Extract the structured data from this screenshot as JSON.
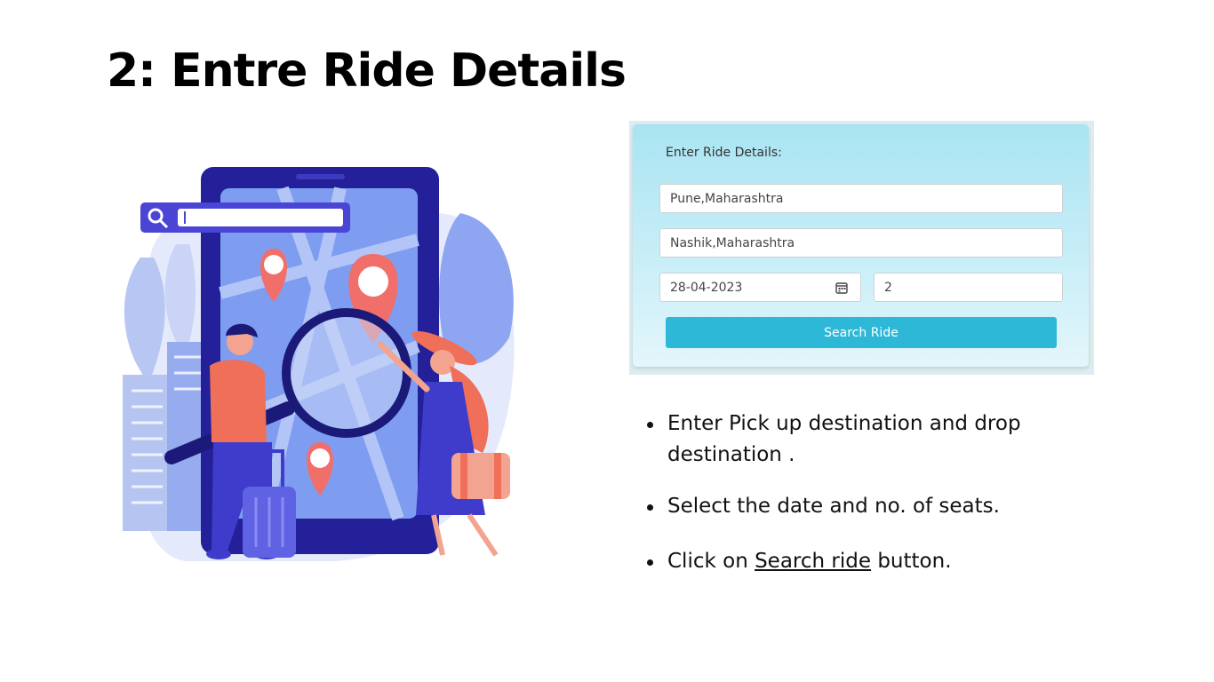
{
  "slide": {
    "title": "2: Entre Ride Details"
  },
  "form": {
    "heading": "Enter Ride Details:",
    "pickup_value": "Pune,Maharashtra",
    "drop_value": "Nashik,Maharashtra",
    "date_value": "28-04-2023",
    "seats_value": "2",
    "search_button_label": "Search Ride",
    "date_icon": "calendar-icon",
    "accent_color": "#2eb8d8"
  },
  "bullets": {
    "item1": "Enter Pick up destination and drop destination .",
    "item2": "Select the date and no. of seats.",
    "item3_prefix": "Click on ",
    "item3_link": "Search ride",
    "item3_suffix": " button."
  },
  "illustration": {
    "icons": [
      "smartphone-icon",
      "map-pin-icon",
      "magnifier-icon",
      "luggage-icon",
      "search-bar-icon"
    ]
  }
}
